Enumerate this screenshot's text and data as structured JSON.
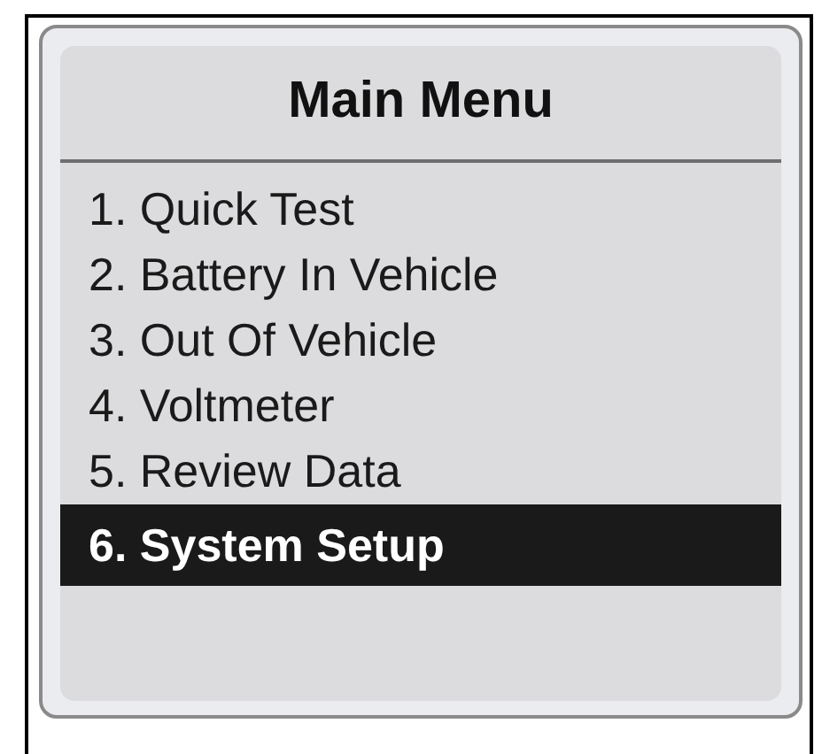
{
  "title": "Main Menu",
  "items": [
    {
      "label": "1. Quick Test",
      "selected": false
    },
    {
      "label": "2. Battery In Vehicle",
      "selected": false
    },
    {
      "label": "3. Out Of Vehicle",
      "selected": false
    },
    {
      "label": "4. Voltmeter",
      "selected": false
    },
    {
      "label": "5. Review Data",
      "selected": false
    },
    {
      "label": "6. System Setup",
      "selected": true
    }
  ]
}
